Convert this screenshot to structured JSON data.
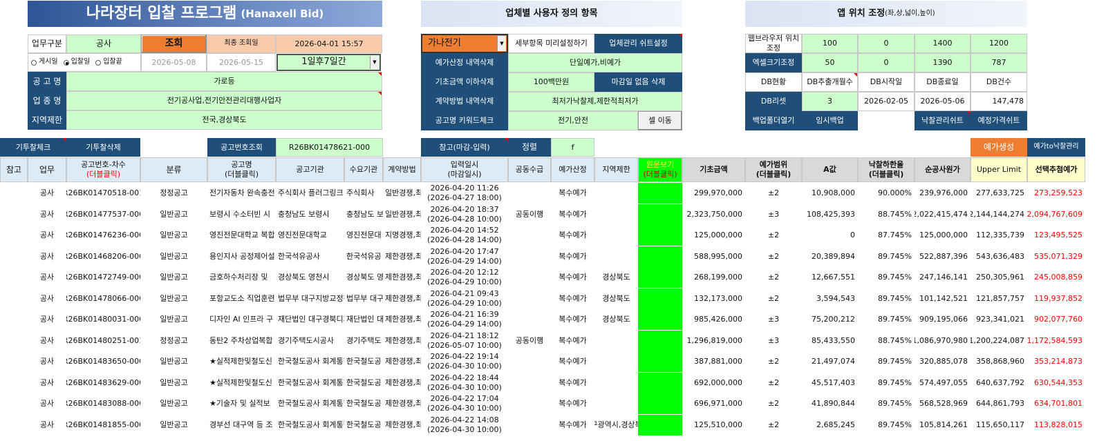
{
  "title": {
    "main": "나라장터 입찰 프로그램",
    "sub": "(Hanaxell Bid)"
  },
  "section_custom": "업체별 사용자 정의 항목",
  "section_app_pos": {
    "main": "앱 위치 조정",
    "sub": "(좌,상,넓이,높이)"
  },
  "left": {
    "work_type_label": "업무구분",
    "work_type_value": "공사",
    "search_button": "조회",
    "last_search_label": "최종 조회일",
    "last_search_value": "2026-04-01 15:57",
    "radio_post": "게시일",
    "radio_bid": "입찰일",
    "radio_bid_end": "입찰끝",
    "date_from": "2026-05-08",
    "date_to": "2026-05-15",
    "period": "1일후7일간",
    "notice_name_label": "공 고 명",
    "notice_name_value": "가로등",
    "industry_label": "업 종 명",
    "industry_value": "전기공사업,전기안전관리대행사업자",
    "region_label": "지역제한",
    "region_value": "전국,경상북도"
  },
  "mid": {
    "company_select": "가나전기",
    "preset_label": "세부항목 미리설정하기",
    "company_sheet_button": "업체관리 쉬트설정",
    "estimate_delete_label": "예가산정 내역삭제",
    "estimate_delete_value": "단일예가,비예가",
    "base_amount_label": "기초금액 이하삭제",
    "base_amount_value": "100백만원",
    "no_deadline_button": "마감일 없음 삭제",
    "contract_delete_label": "계약방법 내역삭제",
    "contract_delete_value": "최저가낙찰제,제한적최저가",
    "keyword_label": "공고명 키워드체크",
    "keyword_value": "전기,안전",
    "cell_move_button": "셀 이동"
  },
  "right": {
    "browser_label": "웹브라우저 위치조정",
    "browser_vals": [
      "100",
      "0",
      "1400",
      "1200"
    ],
    "excel_label": "엑셀크기조정",
    "excel_vals": [
      "50",
      "0",
      "1390",
      "787"
    ],
    "db_headers": [
      "DB현황",
      "DB추출개월수",
      "DB시작일",
      "DB종료일",
      "DB건수"
    ],
    "db_reset_label": "DB리셋",
    "db_vals": [
      "3",
      "2026-02-05",
      "2026-05-06",
      "147,478"
    ],
    "backup_folder_button": "백업폴더열기",
    "temp_backup_button": "임시백업",
    "bid_sheet_button": "낙찰관리쉬트",
    "price_sheet_button": "예정가격쉬트"
  },
  "toolbar": {
    "bid_check": "기투찰체크",
    "bid_delete": "기투찰삭제",
    "notice_search_label": "공고번호조회",
    "notice_search_value": "R26BK01478621-000",
    "ref_label": "참고(마감-입력)",
    "sort_label": "정렬",
    "sort_value": "f",
    "estimate_gen": "예가생성",
    "estimate_to_bid": "예가to낙찰관리"
  },
  "headers": {
    "ref": "참고",
    "work": "업무",
    "notice_no": "공고번호-차수",
    "notice_no_sub": "(더블클릭)",
    "category": "분류",
    "notice_name": "공고명",
    "notice_name_sub": "(더블클릭)",
    "agency": "공고기관",
    "demand": "수요기관",
    "contract": "계약방법",
    "input_date": "입력일시",
    "input_date_sub": "(마감일시)",
    "joint": "공동수급",
    "estimate": "예가산정",
    "region": "지역제한",
    "original": "원문보기",
    "original_sub": "(더블클릭)",
    "base": "기초금액",
    "range": "예가범위",
    "range_sub": "(더블클릭)",
    "a_value": "A값",
    "lower_rate": "낙찰하한율",
    "lower_rate_sub": "(더블클릭)",
    "net_cost": "순공사원가",
    "upper": "Upper Limit",
    "selected": "선택추첨예가"
  },
  "rows": [
    {
      "work": "공사",
      "no": "R26BK01470518-001",
      "cat": "정정공고",
      "name": "전기자동차 완속충전",
      "agency": "주식회사 플러그링크",
      "demand": "주식회사",
      "contract": "일반경쟁,최",
      "d1": "2026-04-20 11:26",
      "d2": "(2026-04-27 18:00)",
      "joint": "",
      "est": "복수예가",
      "region": "",
      "base": "299,970,000",
      "range": "±2",
      "a": "10,908,000",
      "rate": "90.000%",
      "net": "239,976,000",
      "upper": "277,633,725",
      "sel": "273,259,523"
    },
    {
      "work": "공사",
      "no": "R26BK01477537-000",
      "cat": "일반공고",
      "name": "보령시 수소터빈 시",
      "agency": "충청남도 보령시",
      "demand": "충청남도 보",
      "contract": "일반경쟁,최",
      "d1": "2026-04-20 18:37",
      "d2": "(2026-04-28 10:00)",
      "joint": "공동이행",
      "est": "복수예가",
      "region": "",
      "base": "2,323,750,000",
      "range": "±3",
      "a": "108,425,393",
      "rate": "88.745%",
      "net": "2,022,415,474",
      "upper": "2,144,144,274",
      "sel": "2,094,767,609"
    },
    {
      "work": "공사",
      "no": "R26BK01476236-000",
      "cat": "일반공고",
      "name": "영진전문대학교 복합",
      "agency": "영진전문대학교",
      "demand": "영진전문대",
      "contract": "지명경쟁,최",
      "d1": "2026-04-20 14:52",
      "d2": "(2026-04-28 14:00)",
      "joint": "",
      "est": "복수예가",
      "region": "",
      "base": "125,000,000",
      "range": "±2",
      "a": "0",
      "rate": "87.745%",
      "net": "125,000,000",
      "upper": "112,335,739",
      "sel": "123,495,525"
    },
    {
      "work": "공사",
      "no": "R26BK01468206-000",
      "cat": "일반공고",
      "name": "용인지사 공정제어설",
      "agency": "한국석유공사",
      "demand": "한국석유공",
      "contract": "제한경쟁,최",
      "d1": "2026-04-20 17:47",
      "d2": "(2026-04-29 14:00)",
      "joint": "",
      "est": "복수예가",
      "region": "",
      "base": "588,995,000",
      "range": "±2",
      "a": "20,389,894",
      "rate": "89.745%",
      "net": "522,887,396",
      "upper": "543,636,483",
      "sel": "535,071,329"
    },
    {
      "work": "공사",
      "no": "R26BK01472749-000",
      "cat": "일반공고",
      "name": "금호하수처리장 및",
      "agency": "경상북도 영천시",
      "demand": "경상북도 영",
      "contract": "제한경쟁,최",
      "d1": "2026-04-20 12:12",
      "d2": "(2026-04-29 10:00)",
      "joint": "",
      "est": "복수예가",
      "region": "경상북도",
      "base": "268,199,000",
      "range": "±2",
      "a": "12,667,551",
      "rate": "89.745%",
      "net": "247,146,141",
      "upper": "250,305,961",
      "sel": "245,008,859"
    },
    {
      "work": "공사",
      "no": "R26BK01478066-000",
      "cat": "일반공고",
      "name": "포항교도소 직업훈련",
      "agency": "법무부 대구지방교정청",
      "demand": "법무부 대구",
      "contract": "제한경쟁,최",
      "d1": "2026-04-21 09:43",
      "d2": "(2026-04-29 10:00)",
      "joint": "",
      "est": "복수예가",
      "region": "경상북도",
      "base": "132,173,000",
      "range": "±2",
      "a": "3,594,543",
      "rate": "89.745%",
      "net": "101,142,521",
      "upper": "121,857,757",
      "sel": "119,937,852"
    },
    {
      "work": "공사",
      "no": "R26BK01480031-000",
      "cat": "일반공고",
      "name": "디자인 AI 인프라 구",
      "agency": "재단법인 대구경북디자인",
      "demand": "재단법인 대",
      "contract": "제한경쟁,최",
      "d1": "2026-04-21 16:39",
      "d2": "(2026-04-29 14:00)",
      "joint": "",
      "est": "복수예가",
      "region": "경상북도",
      "base": "985,426,000",
      "range": "±3",
      "a": "75,200,212",
      "rate": "89.745%",
      "net": "909,195,066",
      "upper": "923,341,021",
      "sel": "902,077,760"
    },
    {
      "work": "공사",
      "no": "R26BK01480251-001",
      "cat": "정정공고",
      "name": "동탄2 주차상업복합",
      "agency": "경기주택도시공사",
      "demand": "경기주택도",
      "contract": "제한경쟁,최",
      "d1": "2026-04-21 18:12",
      "d2": "(2026-05-07 10:00)",
      "joint": "공동이행",
      "est": "복수예가",
      "region": "",
      "base": "1,296,819,000",
      "range": "±3",
      "a": "85,433,550",
      "rate": "88.745%",
      "net": "1,086,970,980",
      "upper": "1,200,224,087",
      "sel": "1,172,584,593"
    },
    {
      "work": "공사",
      "no": "R26BK01483650-000",
      "cat": "일반공고",
      "name": "★실적제한및철도신",
      "agency": "한국철도공사 회계통합센터",
      "demand": "한국철도공",
      "contract": "제한경쟁,최",
      "d1": "2026-04-22 19:14",
      "d2": "(2026-04-30 10:00)",
      "joint": "",
      "est": "복수예가",
      "region": "",
      "base": "387,881,000",
      "range": "±2",
      "a": "21,497,074",
      "rate": "89.745%",
      "net": "320,885,078",
      "upper": "358,868,960",
      "sel": "353,214,873"
    },
    {
      "work": "공사",
      "no": "R26BK01483629-000",
      "cat": "일반공고",
      "name": "★실적제한및철도신",
      "agency": "한국철도공사 회계통합센터",
      "demand": "한국철도공",
      "contract": "제한경쟁,최",
      "d1": "2026-04-22 18:44",
      "d2": "(2026-04-30 10:00)",
      "joint": "",
      "est": "복수예가",
      "region": "",
      "base": "692,000,000",
      "range": "±2",
      "a": "45,517,403",
      "rate": "89.745%",
      "net": "574,497,055",
      "upper": "640,637,792",
      "sel": "630,544,353"
    },
    {
      "work": "공사",
      "no": "R26BK01483088-000",
      "cat": "일반공고",
      "name": "★기술자 및 실적보",
      "agency": "한국철도공사 회계통합센터",
      "demand": "한국철도공",
      "contract": "제한경쟁,최",
      "d1": "2026-04-22 17:04",
      "d2": "(2026-04-30 10:00)",
      "joint": "",
      "est": "복수예가",
      "region": "",
      "base": "696,971,000",
      "range": "±2",
      "a": "41,890,844",
      "rate": "89.745%",
      "net": "568,528,969",
      "upper": "644,861,793",
      "sel": "634,701,801"
    },
    {
      "work": "공사",
      "no": "R26BK01481855-000",
      "cat": "일반공고",
      "name": "경부선 대구역 등 조",
      "agency": "한국철도공사 회계통합센터",
      "demand": "한국철도공",
      "contract": "제한경쟁,최",
      "d1": "2026-04-22 14:08",
      "d2": "(2026-04-30 10:00)",
      "joint": "",
      "est": "복수예가",
      "region": "대구광역시,경상북도",
      "base": "125,510,000",
      "range": "±2",
      "a": "2,685,245",
      "rate": "89.745%",
      "net": "105,814,261",
      "upper": "115,650,117",
      "sel": "113,828,015"
    }
  ]
}
